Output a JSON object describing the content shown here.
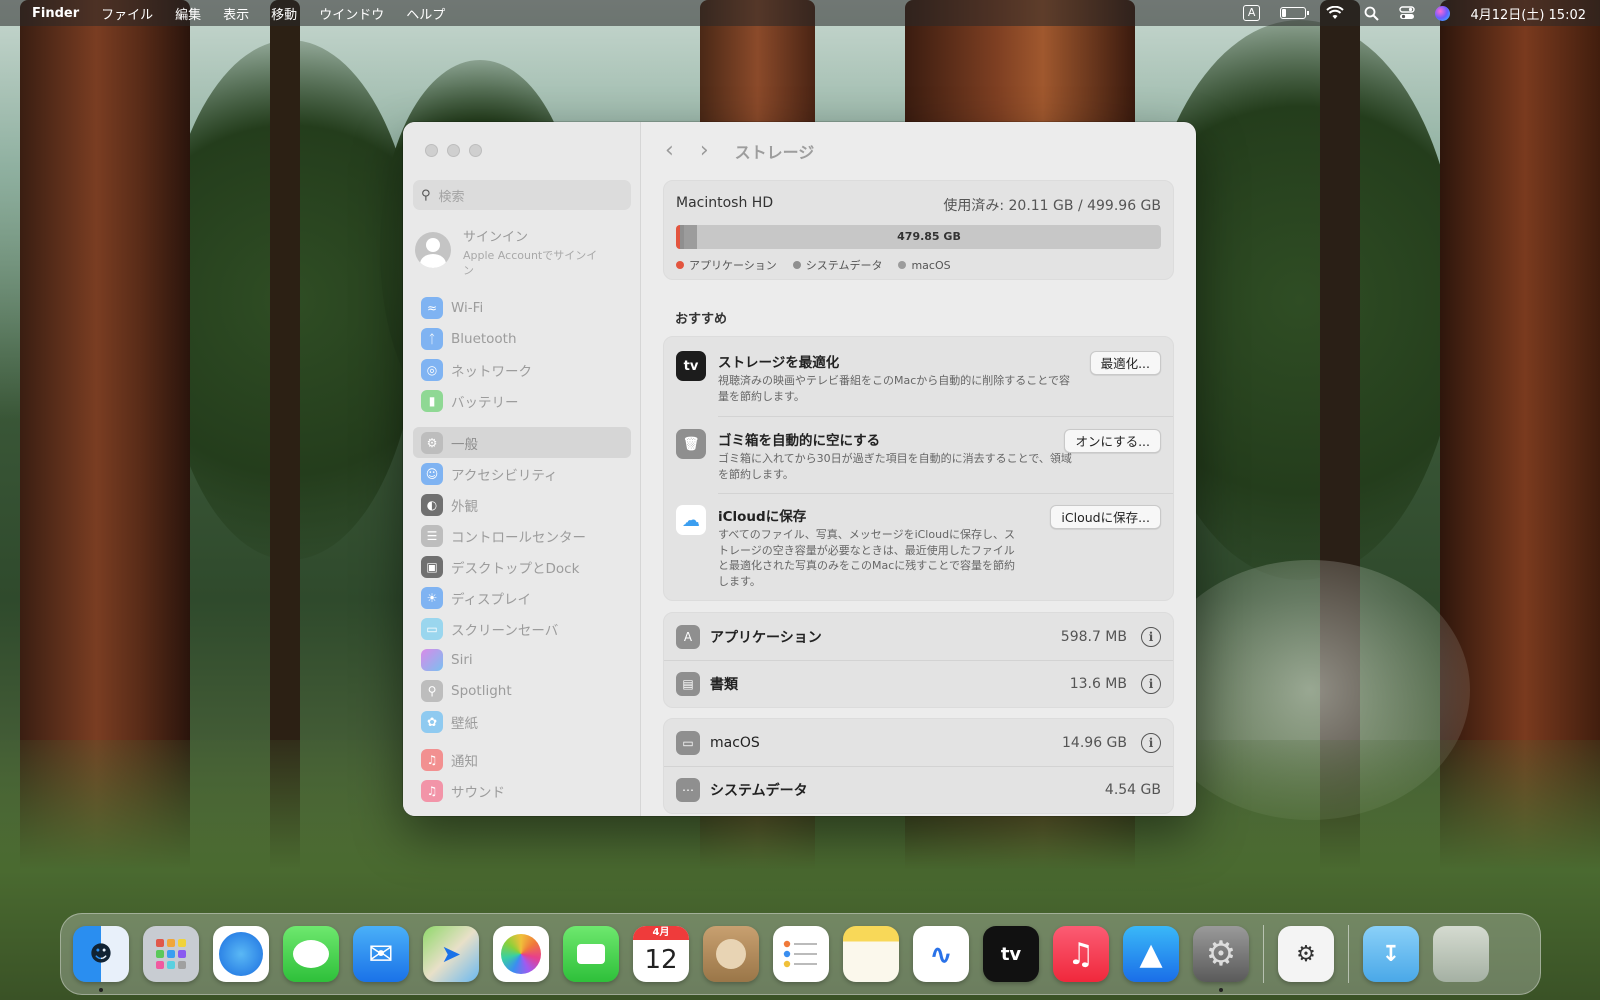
{
  "menubar": {
    "app": "Finder",
    "items": [
      "ファイル",
      "編集",
      "表示",
      "移動",
      "ウインドウ",
      "ヘルプ"
    ],
    "input_indicator": "A",
    "datetime": "4月12日(土) 15:02"
  },
  "sidebar": {
    "search_placeholder": "検索",
    "account": {
      "title": "サインイン",
      "subtitle": "Apple Accountでサインイン"
    },
    "items": [
      {
        "label": "Wi-Fi",
        "icon": "wifi-icon",
        "color": "#3b8ef0"
      },
      {
        "label": "Bluetooth",
        "icon": "bluetooth-icon",
        "color": "#3b8ef0"
      },
      {
        "label": "ネットワーク",
        "icon": "globe-icon",
        "color": "#3b8ef0"
      },
      {
        "label": "バッテリー",
        "icon": "battery-icon",
        "color": "#4cc454"
      },
      {
        "label": "一般",
        "icon": "gear-icon",
        "color": "#9a9a9a",
        "selected": true
      },
      {
        "label": "アクセシビリティ",
        "icon": "accessibility-icon",
        "color": "#3b8ef0"
      },
      {
        "label": "外観",
        "icon": "appearance-icon",
        "color": "#2a2a2a"
      },
      {
        "label": "コントロールセンター",
        "icon": "control-center-icon",
        "color": "#9a9a9a"
      },
      {
        "label": "デスクトップとDock",
        "icon": "dock-icon",
        "color": "#2a2a2a"
      },
      {
        "label": "ディスプレイ",
        "icon": "display-icon",
        "color": "#3b8ef0"
      },
      {
        "label": "スクリーンセーバ",
        "icon": "screensaver-icon",
        "color": "#5ac8e8"
      },
      {
        "label": "Siri",
        "icon": "siri-icon",
        "color": "#b04fd8"
      },
      {
        "label": "Spotlight",
        "icon": "spotlight-icon",
        "color": "#9a9a9a"
      },
      {
        "label": "壁紙",
        "icon": "wallpaper-icon",
        "color": "#3fa8e8"
      },
      {
        "label": "通知",
        "icon": "notifications-icon",
        "color": "#ef4a4a"
      },
      {
        "label": "サウンド",
        "icon": "sound-icon",
        "color": "#ef4a6a"
      }
    ]
  },
  "main": {
    "title": "ストレージ",
    "disk": {
      "name": "Macintosh HD",
      "used": "使用済み: 20.11 GB / 499.96 GB",
      "free": "479.85 GB",
      "legend": [
        "アプリケーション",
        "システムデータ",
        "macOS"
      ],
      "legend_colors": [
        "#e3553f",
        "#8f8f8f",
        "#9c9c9c"
      ]
    },
    "recommendations_label": "おすすめ",
    "recommendations": [
      {
        "title": "ストレージを最適化",
        "desc": "視聴済みの映画やテレビ番組をこのMacから自動的に削除することで容量を節約します。",
        "button": "最適化...",
        "icon": "apple-tv-icon"
      },
      {
        "title": "ゴミ箱を自動的に空にする",
        "desc": "ゴミ箱に入れてから30日が過ぎた項目を自動的に消去することで、領域を節約します。",
        "button": "オンにする...",
        "icon": "trash-icon"
      },
      {
        "title": "iCloudに保存",
        "desc": "すべてのファイル、写真、メッセージをiCloudに保存し、ストレージの空き容量が必要なときは、最近使用したファイルと最適化された写真のみをこのMacに残すことで容量を節約します。",
        "button": "iCloudに保存...",
        "icon": "icloud-icon"
      }
    ],
    "categories": [
      {
        "label": "アプリケーション",
        "size": "598.7 MB",
        "icon": "app-store-icon"
      },
      {
        "label": "書類",
        "size": "13.6 MB",
        "icon": "document-icon"
      }
    ],
    "system": [
      {
        "label": "macOS",
        "size": "14.96 GB",
        "icon": "laptop-icon"
      },
      {
        "label": "システムデータ",
        "size": "4.54 GB",
        "icon": "ellipsis-icon"
      }
    ]
  },
  "dock": {
    "calendar_month": "4月",
    "calendar_day": "12",
    "tv_label": "tv",
    "apps": [
      "finder-icon",
      "launchpad-icon",
      "safari-icon",
      "messages-icon",
      "mail-icon",
      "maps-icon",
      "photos-icon",
      "facetime-icon",
      "calendar-icon",
      "contacts-icon",
      "reminders-icon",
      "notes-icon",
      "freeform-icon",
      "apple-tv-icon",
      "music-icon",
      "app-store-icon",
      "system-settings-icon",
      "disk-utility-icon",
      "downloads-folder-icon",
      "trash-icon"
    ]
  }
}
